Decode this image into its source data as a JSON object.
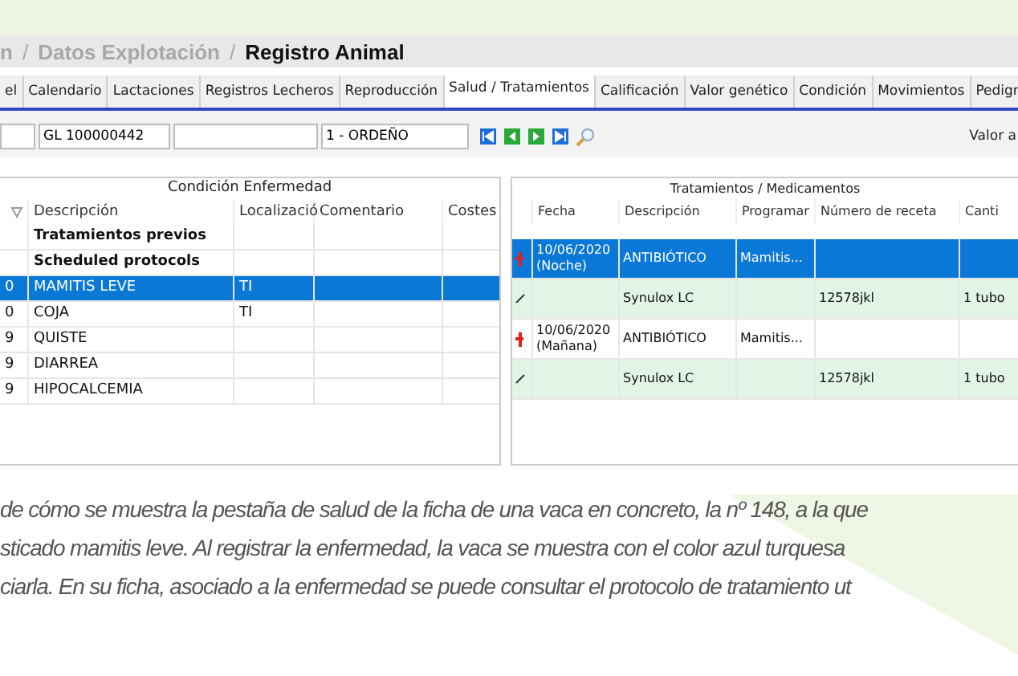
{
  "breadcrumb": [
    {
      "label": "n",
      "current": false
    },
    {
      "separator": "/",
      "label": "Datos Explotación",
      "current": false
    },
    {
      "separator": "/",
      "label": "Registro Animal",
      "current": true
    }
  ],
  "tabs": [
    {
      "label": "el",
      "selected": false
    },
    {
      "label": "Calendario",
      "selected": false
    },
    {
      "label": "Lactaciones",
      "selected": false
    },
    {
      "label": "Registros Lecheros",
      "selected": false
    },
    {
      "label": "Reproducción",
      "selected": false
    },
    {
      "label": "Salud / Tratamientos",
      "selected": true
    },
    {
      "label": "Calificación",
      "selected": false
    },
    {
      "label": "Valor genético",
      "selected": false
    },
    {
      "label": "Condición",
      "selected": false
    },
    {
      "label": "Movimientos",
      "selected": false
    },
    {
      "label": "Pedigr",
      "selected": false
    }
  ],
  "toolbar": {
    "animal_field": "GL 100000442",
    "group_field": "1 - ORDEÑO",
    "value_label": "Valor a"
  },
  "disease_table": {
    "title": "Condición Enfermedad",
    "columns": [
      "",
      "Descripción",
      "Localizació",
      "Comentario",
      "Costes"
    ],
    "rows": [
      {
        "kind": "group",
        "cells": [
          "",
          "Tratamientos previos",
          "",
          "",
          ""
        ],
        "selected": false
      },
      {
        "kind": "group",
        "cells": [
          "",
          "Scheduled protocols",
          "",
          "",
          ""
        ],
        "selected": false
      },
      {
        "kind": "item",
        "cells": [
          "0",
          "MAMITIS LEVE",
          "TI",
          "",
          ""
        ],
        "selected": true
      },
      {
        "kind": "item",
        "cells": [
          "0",
          "COJA",
          "TI",
          "",
          ""
        ],
        "selected": false
      },
      {
        "kind": "item",
        "cells": [
          "9",
          "QUISTE",
          "",
          "",
          ""
        ],
        "selected": false
      },
      {
        "kind": "item",
        "cells": [
          "9",
          "DIARREA",
          "",
          "",
          ""
        ],
        "selected": false
      },
      {
        "kind": "item",
        "cells": [
          "9",
          "HIPOCALCEMIA",
          "",
          "",
          ""
        ],
        "selected": false
      }
    ]
  },
  "treatment_table": {
    "title": "Tratamientos / Medicamentos",
    "columns": [
      "Fecha",
      "Descripción",
      "Programar",
      "Número de receta",
      "Canti"
    ],
    "rows": [
      {
        "kind": "treatment",
        "cells": [
          "10/06/2020 (Noche)",
          "ANTIBIÓTICO",
          "Mamitis...",
          "",
          ""
        ],
        "selected": true
      },
      {
        "kind": "medicine",
        "cells": [
          "",
          "Synulox LC",
          "",
          "12578jkl",
          "1 tubo"
        ],
        "selected": false
      },
      {
        "kind": "treatment",
        "cells": [
          "10/06/2020 (Mañana)",
          "ANTIBIÓTICO",
          "Mamitis...",
          "",
          ""
        ],
        "selected": false
      },
      {
        "kind": "medicine",
        "cells": [
          "",
          "Synulox LC",
          "",
          "12578jkl",
          "1 tubo"
        ],
        "selected": false
      }
    ]
  },
  "caption": [
    "de cómo se muestra la pestaña de salud de la ficha de una vaca en concreto, la nº 148, a la que",
    "sticado mamitis leve. Al registrar la enfermedad, la vaca se muestra con el color azul turquesa",
    "ciarla. En su ficha, asociado a la enfermedad se puede consultar el protocolo de tratamiento ut"
  ]
}
